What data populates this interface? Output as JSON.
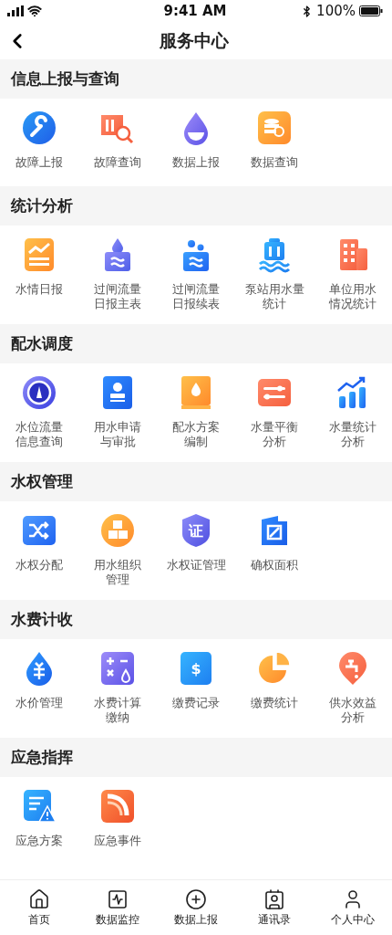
{
  "status_bar": {
    "time": "9:41 AM",
    "battery": "100%"
  },
  "nav": {
    "title": "服务中心"
  },
  "sections": [
    {
      "title": "信息上报与查询",
      "items": [
        {
          "lines": [
            "故障上报"
          ]
        },
        {
          "lines": [
            "故障查询"
          ]
        },
        {
          "lines": [
            "数据上报"
          ]
        },
        {
          "lines": [
            "数据查询"
          ]
        }
      ]
    },
    {
      "title": "统计分析",
      "items": [
        {
          "lines": [
            "水情日报"
          ]
        },
        {
          "lines": [
            "过闸流量",
            "日报主表"
          ]
        },
        {
          "lines": [
            "过闸流量",
            "日报续表"
          ]
        },
        {
          "lines": [
            "泵站用水量",
            "统计"
          ]
        },
        {
          "lines": [
            "单位用水",
            "情况统计"
          ]
        }
      ]
    },
    {
      "title": "配水调度",
      "items": [
        {
          "lines": [
            "水位流量",
            "信息查询"
          ]
        },
        {
          "lines": [
            "用水申请",
            "与审批"
          ]
        },
        {
          "lines": [
            "配水方案",
            "编制"
          ]
        },
        {
          "lines": [
            "水量平衡",
            "分析"
          ]
        },
        {
          "lines": [
            "水量统计",
            "分析"
          ]
        }
      ]
    },
    {
      "title": "水权管理",
      "items": [
        {
          "lines": [
            "水权分配"
          ]
        },
        {
          "lines": [
            "用水组织",
            "管理"
          ]
        },
        {
          "lines": [
            "水权证管理"
          ],
          "icon_text": "证"
        },
        {
          "lines": [
            "确权面积"
          ]
        }
      ]
    },
    {
      "title": "水费计收",
      "items": [
        {
          "lines": [
            "水价管理"
          ]
        },
        {
          "lines": [
            "水费计算",
            "缴纳"
          ]
        },
        {
          "lines": [
            "缴费记录"
          ],
          "icon_text": "$"
        },
        {
          "lines": [
            "缴费统计"
          ]
        },
        {
          "lines": [
            "供水效益",
            "分析"
          ]
        }
      ]
    },
    {
      "title": "应急指挥",
      "items": [
        {
          "lines": [
            "应急方案"
          ]
        },
        {
          "lines": [
            "应急事件"
          ]
        }
      ]
    }
  ],
  "tab_bar": [
    {
      "label": "首页"
    },
    {
      "label": "数据监控"
    },
    {
      "label": "数据上报"
    },
    {
      "label": "通讯录"
    },
    {
      "label": "个人中心"
    }
  ]
}
